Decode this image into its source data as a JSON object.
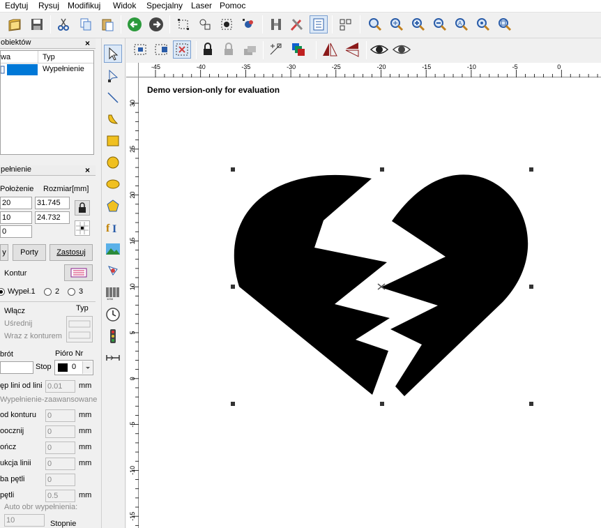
{
  "menu": [
    "Edytuj",
    "Rysuj",
    "Modifikuj",
    "Widok",
    "Specjalny",
    "Laser",
    "Pomoc"
  ],
  "objects_panel": {
    "title": "obiektów",
    "col_name": "wa",
    "col_type": "Typ",
    "row_type": "Wypełnienie"
  },
  "fill_panel": {
    "title": "pełnienie",
    "pos_label": "Położenie",
    "size_label": "Rozmiar[mm]",
    "pos_x": "20",
    "pos_y": "10",
    "size_w": "31.745",
    "size_h": "24.732",
    "extra_field": "0",
    "btn_left": "y",
    "btn_ports": "Porty",
    "btn_apply": "Zastosuj",
    "contour_label": "Kontur",
    "radio1": "Wypeł.1",
    "radio2": "2",
    "radio3": "3",
    "enable_label": "Włącz",
    "type_label": "Typ",
    "average_label": "Uśrednij",
    "with_contour_label": "Wraz z konturem",
    "turn_label": "brót",
    "pen_label": "Pióro Nr",
    "stop_label": "Stop",
    "pen_value": "0",
    "line_step_label": "ęp lini od lini",
    "line_step_value": "0.01",
    "unit_mm": "mm",
    "advanced_label": "Wypełnienie-zaawansowane",
    "from_contour_label": "od konturu",
    "from_contour_value": "0",
    "start_label": "oocznij",
    "start_value": "0",
    "end_label": "ończ",
    "end_value": "0",
    "line_red_label": "ukcja linii",
    "line_red_value": "0",
    "loop_label": "ba pętli",
    "loop_value": "0",
    "loop2_label": "pętli",
    "loop2_value": "0.5",
    "auto_label": "Auto obr wypełnienia:",
    "auto_value": "10",
    "degrees_label": "Stopnie"
  },
  "canvas": {
    "watermark": "Demo version-only for evaluation"
  },
  "ruler": {
    "h_ticks": [
      "-45",
      "-40",
      "-35",
      "-30",
      "-25",
      "-20",
      "-15",
      "-10",
      "-5",
      "0"
    ],
    "v_ticks": [
      "30",
      "25",
      "20",
      "15",
      "10",
      "5",
      "0",
      "-5",
      "-10",
      "-15"
    ]
  },
  "icons": {
    "toolbar1": [
      "open-folder-icon",
      "save-icon",
      "cut-icon",
      "copy-icon",
      "paste-icon",
      "undo-icon",
      "redo-icon",
      "group-icon",
      "ungroup-icon",
      "break-icon",
      "nodes-icon",
      "weld-icon",
      "tools-icon",
      "properties-icon",
      "arrange-icon",
      "zoom-icon",
      "zoom-in-icon",
      "zoom-plus-icon",
      "zoom-minus-icon",
      "zoom-all-icon",
      "zoom-selected-icon",
      "zoom-page-icon"
    ],
    "left_tools": [
      "select-icon",
      "node-edit-icon",
      "line-icon",
      "curve-icon",
      "rectangle-icon",
      "circle-icon",
      "ellipse-icon",
      "polygon-icon",
      "text-icon",
      "image-icon",
      "vector-icon",
      "barcode-icon",
      "clock-icon",
      "light-icon",
      "io-icon"
    ]
  },
  "colors": {
    "accent": "#0078d7",
    "selection": "#0078d7"
  }
}
